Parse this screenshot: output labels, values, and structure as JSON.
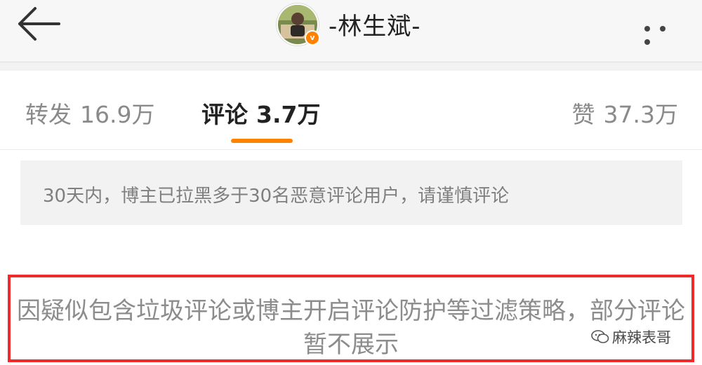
{
  "header": {
    "username": "-林生斌-",
    "icons": {
      "back": "back-arrow-icon",
      "more": "more-dots-icon",
      "verified": "verified-v-badge-icon"
    },
    "verified_letter": "v"
  },
  "tabs": [
    {
      "label": "转发",
      "count": "16.9万",
      "active": false
    },
    {
      "label": "评论",
      "count": "3.7万",
      "active": true
    },
    {
      "label": "赞",
      "count": "37.3万",
      "active": false
    }
  ],
  "notice": "30天内，博主已拉黑多于30名恶意评论用户，请谨慎评论",
  "filter_message": "因疑似包含垃圾评论或博主开启评论防护等过滤策略，部分评论暂不展示",
  "watermark": "麻辣表哥",
  "colors": {
    "accent": "#ff8200",
    "highlight_box": "#ee2a2a"
  }
}
